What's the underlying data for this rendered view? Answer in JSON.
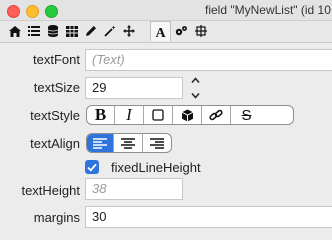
{
  "window": {
    "title": "field \"MyNewList\" (id 10"
  },
  "toolbar": {
    "tabs": [
      {
        "icon": "home-icon"
      },
      {
        "icon": "list-icon"
      },
      {
        "icon": "database-icon"
      },
      {
        "icon": "table-icon"
      },
      {
        "icon": "pencil-icon"
      },
      {
        "icon": "magic-wand-icon"
      },
      {
        "icon": "move-icon"
      },
      {
        "icon": "text-icon",
        "label": "A",
        "active": true
      },
      {
        "icon": "gears-icon"
      },
      {
        "icon": "resize-icon"
      }
    ]
  },
  "props": {
    "textFont": {
      "label": "textFont",
      "placeholder": "(Text)"
    },
    "textSize": {
      "label": "textSize",
      "value": "29"
    },
    "textStyle": {
      "label": "textStyle",
      "options": [
        {
          "name": "bold",
          "glyph": "B"
        },
        {
          "name": "italic",
          "glyph": "I"
        },
        {
          "name": "box",
          "glyph": ""
        },
        {
          "name": "threeD-box",
          "glyph": ""
        },
        {
          "name": "link",
          "glyph": ""
        },
        {
          "name": "strikeout",
          "glyph": "S"
        }
      ]
    },
    "textAlign": {
      "label": "textAlign",
      "options": [
        "left",
        "center",
        "right"
      ],
      "selected": "left"
    },
    "fixedLineHeight": {
      "label": "fixedLineHeight",
      "checked": true
    },
    "textHeight": {
      "label": "textHeight",
      "placeholder": "38"
    },
    "margins": {
      "label": "margins",
      "value": "30"
    }
  },
  "colors": {
    "accent": "#2f73dc"
  }
}
